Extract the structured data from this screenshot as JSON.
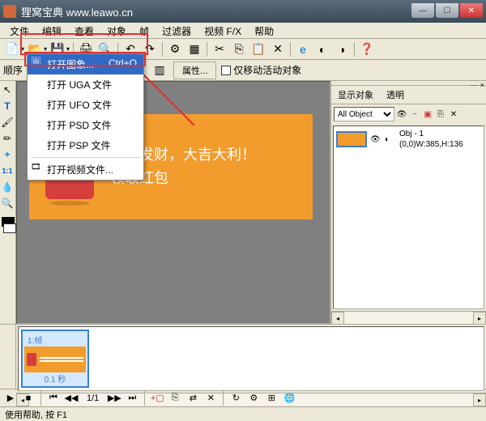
{
  "titlebar": {
    "text": "狸窝宝典  www.leawo.cn"
  },
  "menu": {
    "file": "文件",
    "edit": "编辑",
    "search": "查看",
    "object": "对象",
    "frame": "帧",
    "filter": "过滤器",
    "video": "视频 F/X",
    "help": "帮助"
  },
  "toolbar2": {
    "order_label": "顺序",
    "properties": "属性...",
    "only_move": "仅移动活动对象"
  },
  "right": {
    "show_obj": "显示对象",
    "transparent": "透明",
    "combo": "All Object",
    "obj_name": "Obj - 1",
    "obj_coords": "(0,0)W:385,H:136"
  },
  "banner": {
    "line1": "恭喜发财，大吉大利！",
    "line2": "领取红包"
  },
  "timeline": {
    "frame_label": "1:帧",
    "frame_time": "0.1 秒"
  },
  "playbar": {
    "counter": "1/1"
  },
  "status": {
    "text": "使用帮助, 按 F1"
  },
  "dropdown": {
    "open_image": "打开图象...",
    "open_image_sc": "Ctrl+O",
    "open_uga": "打开 UGA 文件",
    "open_ufo": "打开 UFO 文件",
    "open_psd": "打开 PSD 文件",
    "open_psp": "打开 PSP 文件",
    "open_video": "打开视频文件..."
  }
}
